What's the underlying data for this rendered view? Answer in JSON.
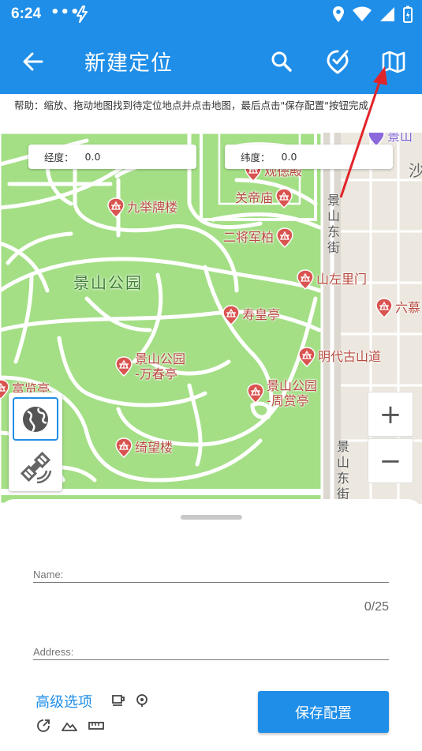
{
  "status": {
    "time": "6:24",
    "dots": "•••"
  },
  "appbar": {
    "title": "新建定位"
  },
  "help": {
    "text": "帮助：缩放、拖动地图找到待定位地点并点击地图，最后点击\"保存配置\"按钮完成"
  },
  "coords": {
    "lng_label": "经度：",
    "lng_value": "0.0",
    "lat_label": "纬度：",
    "lat_value": "0.0"
  },
  "map": {
    "park_label": "景山公园",
    "pois": [
      "观德殿",
      "关帝庙",
      "九举牌楼",
      "二将军柏",
      "山左里门",
      "寿皇亭",
      "六慕",
      "明代古山道",
      "景山公园\n-万春亭",
      "景山公园\n-周赏亭",
      "绮望楼",
      "富览亭",
      "景山"
    ],
    "streets": [
      "景山东街",
      "景山东街",
      "沙"
    ]
  },
  "zoom": {
    "in": "+",
    "out": "−"
  },
  "form": {
    "name_placeholder": "Name:",
    "counter": "0/25",
    "address_placeholder": "Address:",
    "advanced_label": "高级选项",
    "save_label": "保存配置"
  },
  "colors": {
    "accent": "#1f8ee8",
    "map_green": "#a4df86",
    "poi_red": "#d9534f",
    "arrow_red": "#e0252a"
  },
  "icons": [
    "back-arrow-icon",
    "search-icon",
    "check-badge-icon",
    "map-icon",
    "globe-icon",
    "satellite-link-icon",
    "coffee-icon",
    "location-marker-icon",
    "share-icon",
    "terrain-icon",
    "ruler-icon"
  ]
}
